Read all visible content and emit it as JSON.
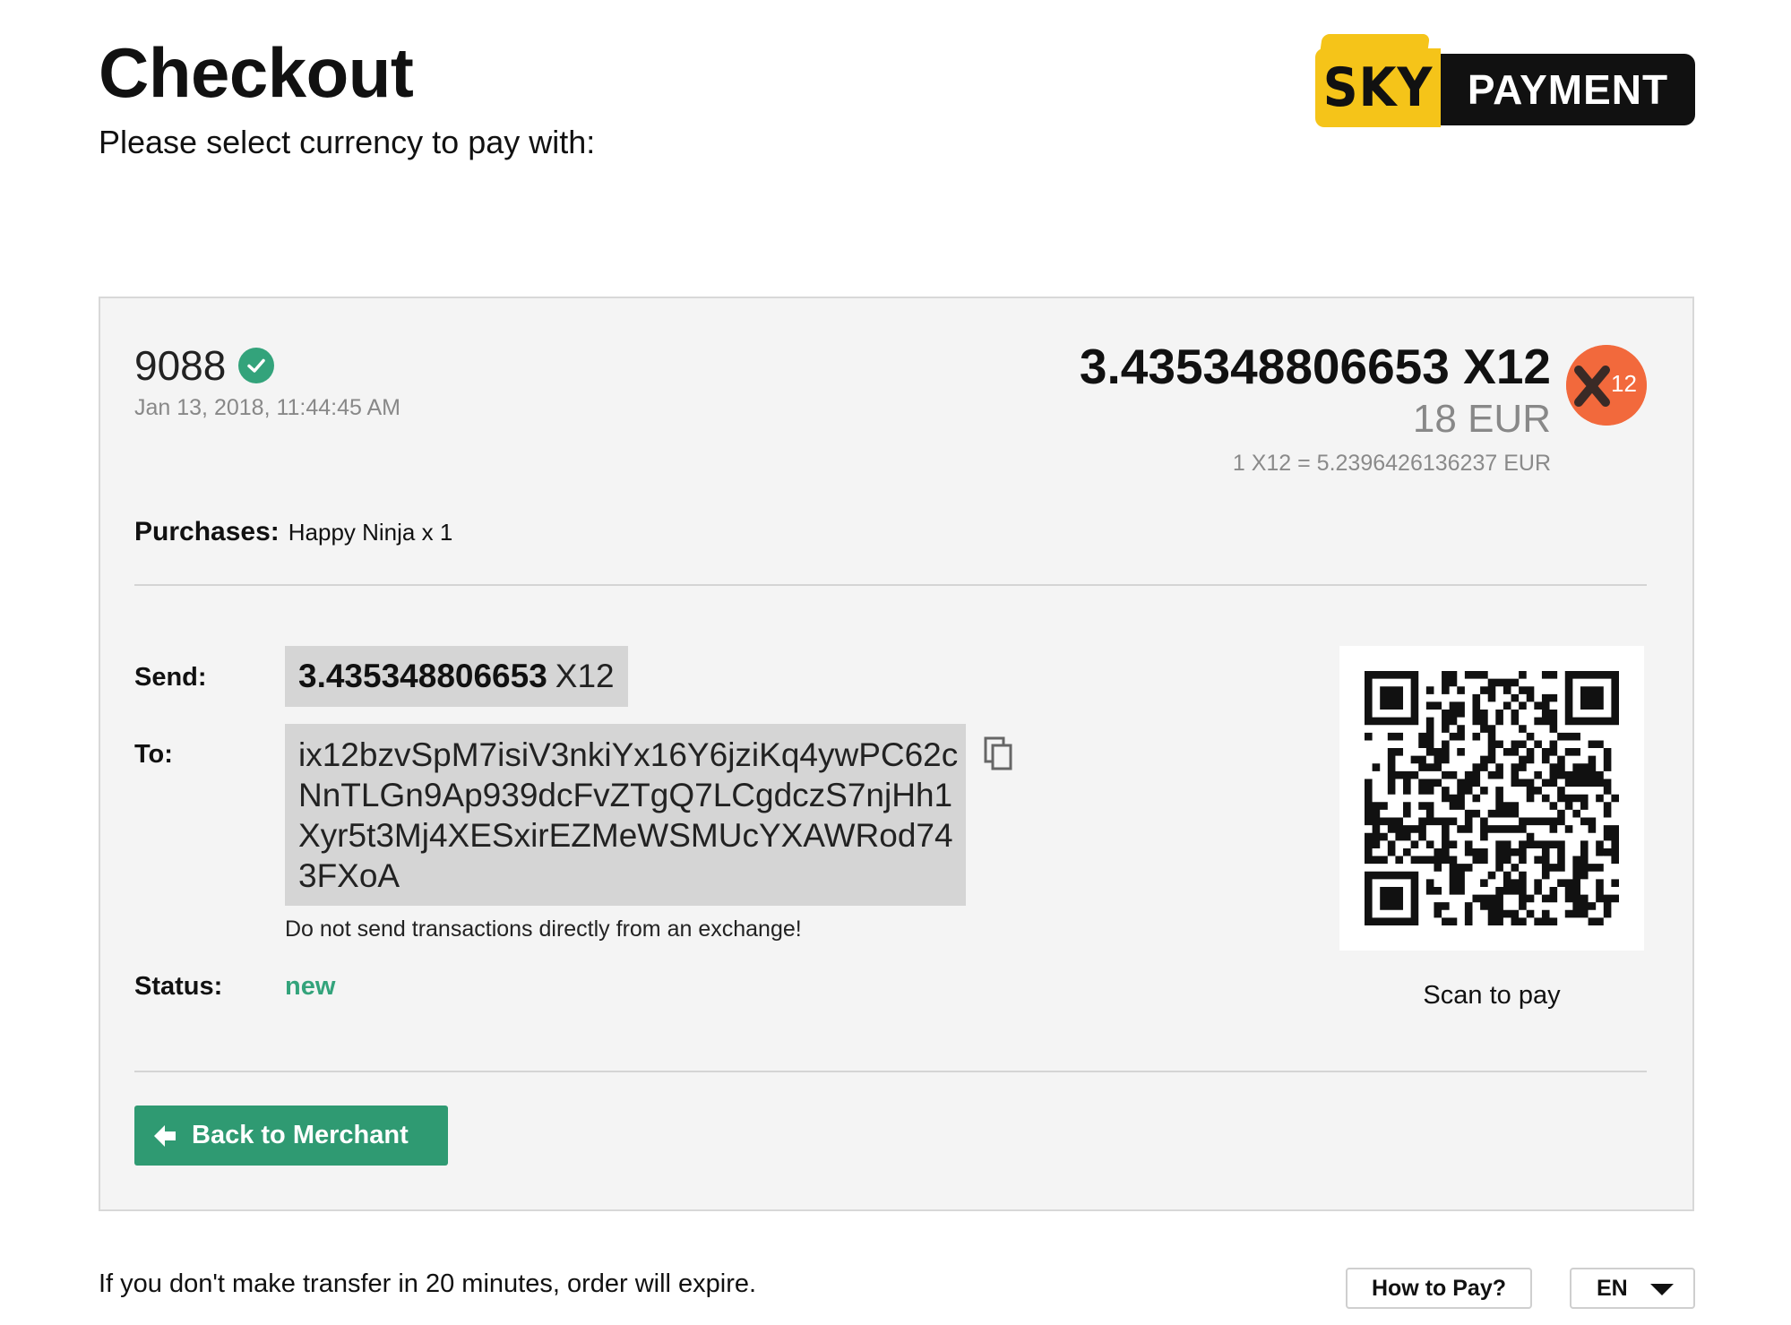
{
  "header": {
    "title": "Checkout",
    "subtitle": "Please select currency to pay with:"
  },
  "logo": {
    "brand_left": "SKY",
    "brand_right": "PAYMENT",
    "colors": {
      "yellow": "#f5c419",
      "black": "#111111"
    }
  },
  "order": {
    "id": "9088",
    "date": "Jan 13, 2018, 11:44:45 AM",
    "amount_crypto": "3.435348806653 X12",
    "amount_fiat": "18 EUR",
    "rate": "1 X12 = 5.2396426136237 EUR",
    "coin_icon": "x12-coin-icon",
    "coin_color": "#f2693c"
  },
  "purchases": {
    "label": "Purchases:",
    "value": "Happy Ninja x 1"
  },
  "payment": {
    "send_label": "Send:",
    "send_amount": "3.435348806653",
    "send_currency": "X12",
    "to_label": "To:",
    "address_lines": [
      "ix12bzvSpM7isiV3nkiYx16Y6jziKq4ywPC62c",
      "NnTLGn9Ap939dcFvZTgQ7LCgdczS7njHh1",
      "Xyr5t3Mj4XESxirEZMeWSMUcYXAWRod74",
      "3FXoA"
    ],
    "warning": "Do not send transactions directly from an exchange!",
    "status_label": "Status:",
    "status_value": "new",
    "status_color": "#33a37b",
    "scan_label": "Scan to pay"
  },
  "actions": {
    "back_label": "Back to Merchant",
    "back_color": "#2f9a72"
  },
  "footer": {
    "expire_note": "If you don't make transfer in 20 minutes, order will expire.",
    "howto_label": "How to Pay?",
    "language": "EN"
  }
}
